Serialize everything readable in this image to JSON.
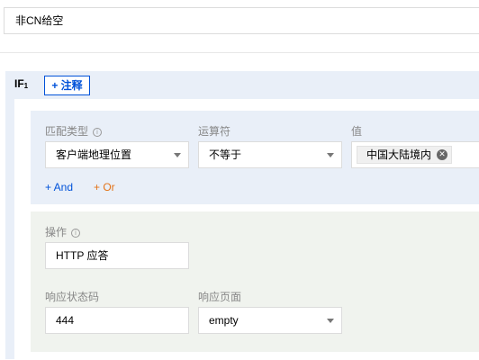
{
  "rule_name": "非CN给空",
  "rule": {
    "if_label": "IF",
    "if_index": "1",
    "note_button": "+ 注释",
    "conditions": {
      "match_type_label": "匹配类型",
      "operator_label": "运算符",
      "value_label": "值",
      "match_type_value": "客户端地理位置",
      "operator_value": "不等于",
      "value_tag": "中国大陆境内",
      "and_label": "+ And",
      "or_label": "+ Or"
    },
    "operation": {
      "action_label": "操作",
      "action_value": "HTTP 应答",
      "status_code_label": "响应状态码",
      "status_code_value": "444",
      "page_label": "响应页面",
      "page_value": "empty"
    }
  },
  "icons": {
    "info": "info-circle-icon",
    "dropdown": "chevron-down-icon",
    "tag_remove": "close-circle-icon"
  },
  "colors": {
    "primary": "#0052d9",
    "or_accent": "#e37318",
    "condition_panel_bg": "#e9eff8",
    "operation_panel_bg": "#f0f3ee"
  }
}
